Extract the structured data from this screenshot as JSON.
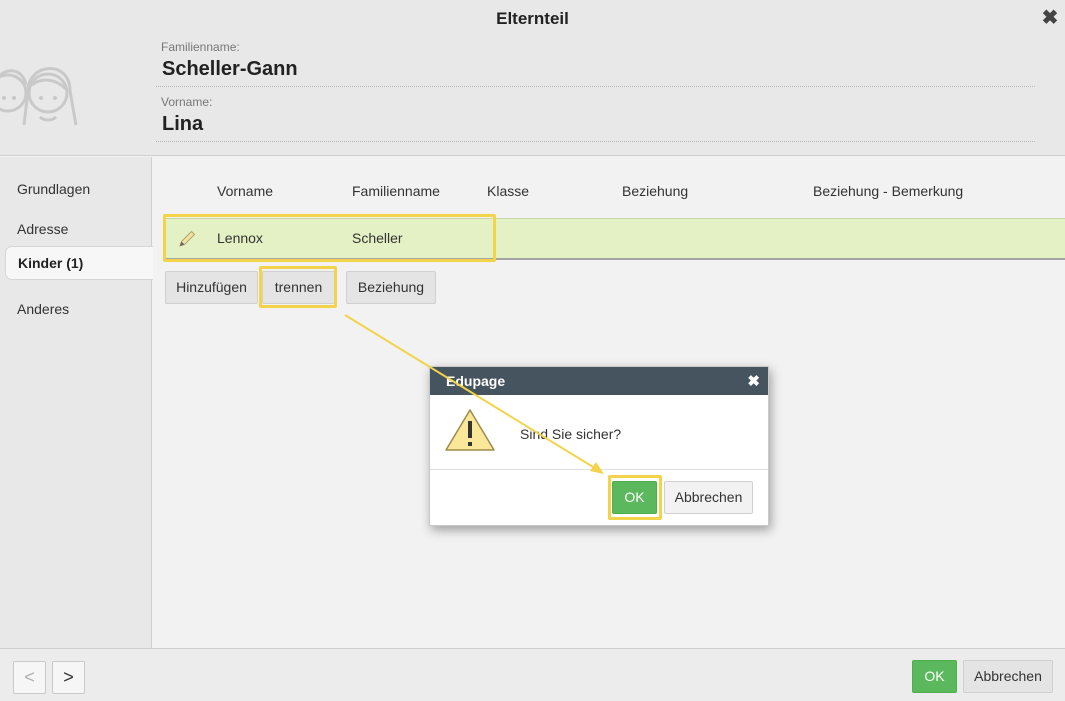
{
  "window": {
    "title": "Elternteil",
    "close_icon": "close-icon"
  },
  "person": {
    "last_name_label": "Familienname:",
    "last_name": "Scheller-Gann",
    "first_name_label": "Vorname:",
    "first_name": "Lina"
  },
  "sidebar": {
    "items": [
      {
        "label": "Grundlagen",
        "active": false
      },
      {
        "label": "Adresse",
        "active": false
      },
      {
        "label": "Kinder (1)",
        "active": true
      },
      {
        "label": "Anderes",
        "active": false
      }
    ]
  },
  "children_table": {
    "columns": [
      "Vorname",
      "Familienname",
      "Klasse",
      "Beziehung",
      "Beziehung - Bemerkung"
    ],
    "rows": [
      {
        "first_name": "Lennox",
        "last_name": "Scheller",
        "class": "",
        "relationship": "",
        "remark": ""
      }
    ]
  },
  "actions": {
    "add": "Hinzufügen",
    "detach": "trennen",
    "relationship": "Beziehung"
  },
  "dialog": {
    "title": "Edupage",
    "message": "Sind Sie sicher?",
    "ok": "OK",
    "cancel": "Abbrechen"
  },
  "footer": {
    "prev": "<",
    "next": ">",
    "ok": "OK",
    "cancel": "Abbrechen"
  },
  "colors": {
    "highlight": "#f2d34a",
    "row_bg": "#e3f1c4",
    "ok_green": "#5cb85c",
    "dialog_bar": "#465460"
  }
}
